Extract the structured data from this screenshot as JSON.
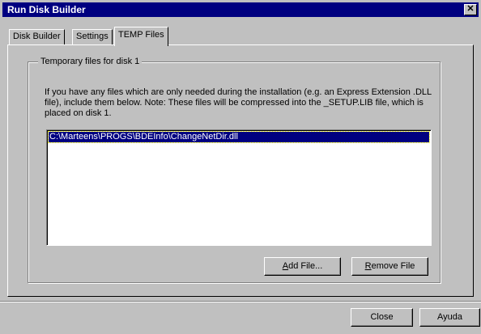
{
  "window": {
    "title": "Run Disk Builder",
    "close_glyph": "✕"
  },
  "tabs": [
    {
      "label": "Disk Builder",
      "active": false
    },
    {
      "label": "Settings",
      "active": false
    },
    {
      "label": "TEMP Files",
      "active": true
    }
  ],
  "group": {
    "legend": "Temporary files for disk 1",
    "description": "If you have any files which are only needed during the installation (e.g. an Express Extension .DLL file), include them below. Note: These files will be compressed into the _SETUP.LIB file, which is placed on disk 1."
  },
  "files": {
    "items": [
      "C:\\Marteens\\PROGS\\BDEInfo\\ChangeNetDir.dll"
    ],
    "selected_index": 0
  },
  "buttons": {
    "add_file": {
      "mnemonic": "A",
      "rest": "dd File..."
    },
    "remove_file": {
      "mnemonic": "R",
      "rest": "emove File"
    },
    "close": "Close",
    "help": "Ayuda"
  },
  "colors": {
    "titlebar": "#000080",
    "face": "#c0c0c0",
    "selection": "#000080"
  }
}
